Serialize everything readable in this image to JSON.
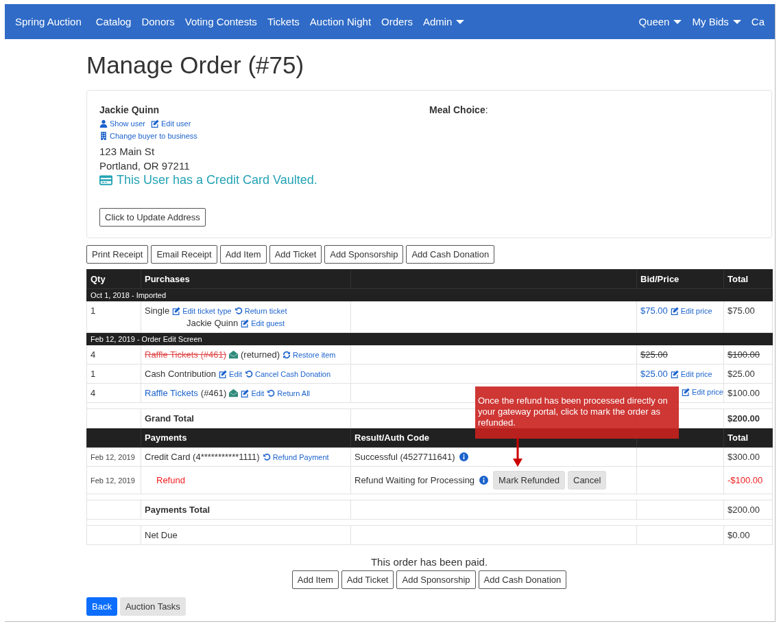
{
  "navbar": {
    "brand": "Spring Auction",
    "items": [
      {
        "label": "Catalog",
        "dropdown": false
      },
      {
        "label": "Donors",
        "dropdown": false
      },
      {
        "label": "Voting Contests",
        "dropdown": false
      },
      {
        "label": "Tickets",
        "dropdown": false
      },
      {
        "label": "Auction Night",
        "dropdown": false
      },
      {
        "label": "Orders",
        "dropdown": false
      },
      {
        "label": "Admin",
        "dropdown": true
      }
    ],
    "right_items": [
      {
        "label": "Queen",
        "dropdown": true
      },
      {
        "label": "My Bids",
        "dropdown": true
      },
      {
        "label": "Ca",
        "dropdown": false
      }
    ]
  },
  "title": "Manage Order (#75)",
  "customer": {
    "name": "Jackie Quinn",
    "links": [
      {
        "kind": "user",
        "label": "Show user"
      },
      {
        "kind": "edit",
        "label": "Edit user"
      }
    ],
    "business_link": {
      "label": "Change buyer to business"
    },
    "address": [
      "123 Main St",
      "Portland, OR 97211"
    ],
    "vaulted": "This User has a Credit Card Vaulted.",
    "meal_label": "Meal Choice",
    "meal_colon": ":",
    "update_button": "Click to Update Address"
  },
  "actions": [
    "Print Receipt",
    "Email Receipt",
    "Add Item",
    "Add Ticket",
    "Add Sponsorship",
    "Add Cash Donation"
  ],
  "table": {
    "columns": {
      "qty": "Qty",
      "purchases": "Purchases",
      "price": "Bid/Price",
      "total": "Total"
    },
    "groups": [
      {
        "heading": "Oct 1, 2018 - Imported",
        "rows": [
          {
            "qty": "1",
            "name": "Single",
            "name_link": false,
            "returned": false,
            "envelope": false,
            "actions": [
              {
                "kind": "edit",
                "label": "Edit ticket type"
              },
              {
                "kind": "undo",
                "label": "Return ticket"
              }
            ],
            "guest": {
              "name": "Jackie Quinn",
              "action": {
                "kind": "edit",
                "label": "Edit guest"
              }
            },
            "price": "$75.00",
            "price_action": "Edit price",
            "total": "$75.00"
          }
        ]
      },
      {
        "heading": "Feb 12, 2019 - Order Edit Screen",
        "rows": [
          {
            "qty": "4",
            "name": "Raffle Tickets (#461)",
            "name_link": false,
            "returned": true,
            "envelope": true,
            "status": "(returned)",
            "actions": [
              {
                "kind": "sync",
                "label": "Restore item"
              }
            ],
            "price": "$25.00",
            "total": "$100.00"
          },
          {
            "qty": "1",
            "name": "Cash Contribution",
            "name_link": false,
            "returned": false,
            "envelope": false,
            "actions": [
              {
                "kind": "edit",
                "label": "Edit"
              },
              {
                "kind": "undo",
                "label": "Cancel Cash Donation"
              }
            ],
            "price": "$25.00",
            "price_action": "Edit price",
            "total": "$25.00"
          },
          {
            "qty": "4",
            "name": "Raffle Tickets",
            "name_link": true,
            "returned": false,
            "ref": "(#461)",
            "envelope": true,
            "actions": [
              {
                "kind": "edit",
                "label": "Edit"
              },
              {
                "kind": "undo",
                "label": "Return All"
              }
            ],
            "price_action": "Edit price",
            "total": "$100.00"
          }
        ]
      }
    ],
    "grand_total": {
      "label": "Grand Total",
      "value": "$200.00"
    },
    "payment_columns": {
      "payments": "Payments",
      "result": "Result/Auth Code",
      "total": "Total"
    },
    "payments": [
      {
        "date": "Feb 12, 2019",
        "kind": "payment",
        "method": "Credit Card (4***********1111)",
        "action": {
          "kind": "undo",
          "label": "Refund Payment"
        },
        "result": "Successful (4527711641)",
        "total": "$300.00",
        "negative": false
      },
      {
        "date": "Feb 12, 2019",
        "kind": "refund",
        "method": "Refund",
        "result": "Refund Waiting for Processing",
        "buttons": [
          {
            "label": "Mark Refunded"
          },
          {
            "label": "Cancel"
          }
        ],
        "total": "-$100.00",
        "negative": true
      }
    ],
    "payments_total": {
      "label": "Payments Total",
      "value": "$200.00"
    },
    "net_due": {
      "label": "Net Due",
      "value": "$0.00"
    }
  },
  "callout": "Once the refund has been processed directly on your gateway portal, click to mark the order as refunded.",
  "paid_message": "This order has been paid.",
  "bottom_actions": [
    "Add Item",
    "Add Ticket",
    "Add Sponsorship",
    "Add Cash Donation"
  ],
  "footer_buttons": [
    {
      "label": "Back",
      "primary": true
    },
    {
      "label": "Auction Tasks",
      "primary": false
    }
  ]
}
